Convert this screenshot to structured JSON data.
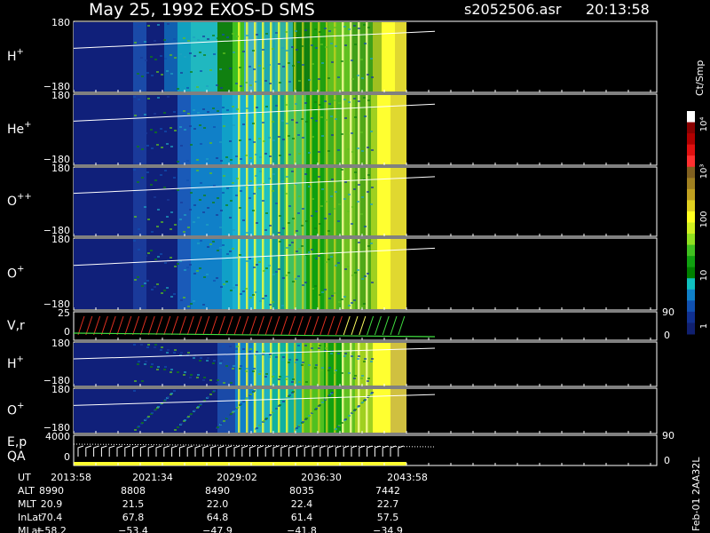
{
  "header": {
    "title": "May 25, 1992   EXOS-D SMS",
    "file": "s2052506.asr",
    "time": "20:13:58"
  },
  "colorbar": {
    "unit": "Ct/Smp",
    "labels": [
      "10⁴",
      "10³",
      "100",
      "10",
      "1"
    ],
    "colors": [
      "#ffffff",
      "#8a0000",
      "#b00000",
      "#e01010",
      "#ff3030",
      "#806020",
      "#a08020",
      "#c0a020",
      "#e0d020",
      "#ffff20",
      "#d0f020",
      "#90e020",
      "#40c020",
      "#10a010",
      "#008000",
      "#10c0c0",
      "#1080c8",
      "#1050b0",
      "#103090",
      "#102070"
    ]
  },
  "panels": [
    {
      "label": "H",
      "sup": "+",
      "ymax": "180",
      "ymin": "−180"
    },
    {
      "label": "He",
      "sup": "+",
      "ymax": "180",
      "ymin": "−180"
    },
    {
      "label": "O",
      "sup": "++",
      "ymax": "180",
      "ymin": "−180"
    },
    {
      "label": "O",
      "sup": "+",
      "ymax": "180",
      "ymin": "−180"
    },
    {
      "label": "V,r",
      "sup": "",
      "ymax": "25",
      "ymin": "0",
      "rmax": "90",
      "rmin": "0"
    },
    {
      "label": "H",
      "sup": "+",
      "ymax": "180",
      "ymin": "−180"
    },
    {
      "label": "O",
      "sup": "+",
      "ymax": "180",
      "ymin": "−180"
    },
    {
      "label": "E,p",
      "label2": "QA",
      "sup": "",
      "ymax": "4000",
      "ymin": "0",
      "rmax": "90",
      "rmin": "0"
    }
  ],
  "footer": {
    "rows": [
      {
        "name": "UT",
        "values": [
          "2013:58",
          "2021:34",
          "2029:02",
          "2036:30",
          "2043:58"
        ]
      },
      {
        "name": "ALT",
        "values": [
          "8990",
          "8808",
          "8490",
          "8035",
          "7442"
        ]
      },
      {
        "name": "MLT",
        "values": [
          "20.9",
          "21.5",
          "22.0",
          "22.4",
          "22.7"
        ]
      },
      {
        "name": "InLat",
        "values": [
          "70.4",
          "67.8",
          "64.8",
          "61.4",
          "57.5"
        ]
      },
      {
        "name": "MLat",
        "values": [
          "−58.2",
          "−53.4",
          "−47.9",
          "−41.8",
          "−34.9"
        ]
      }
    ],
    "side_label": "Feb-01 2AA32L"
  },
  "chart_data": {
    "type": "heatmap",
    "title": "May 25, 1992   EXOS-D SMS",
    "x": [
      "2013:58",
      "2021:34",
      "2029:02",
      "2036:30",
      "2043:58"
    ],
    "xlabel": "UT",
    "panels": [
      "H+",
      "He+",
      "O++",
      "O+",
      "V,r",
      "H+",
      "O+",
      "E,p / QA"
    ],
    "pitch_angle_range": [
      -180,
      180
    ],
    "colorbar_scale": "log",
    "colorbar_range": [
      1,
      10000
    ],
    "colorbar_unit": "Ct/Smp"
  }
}
